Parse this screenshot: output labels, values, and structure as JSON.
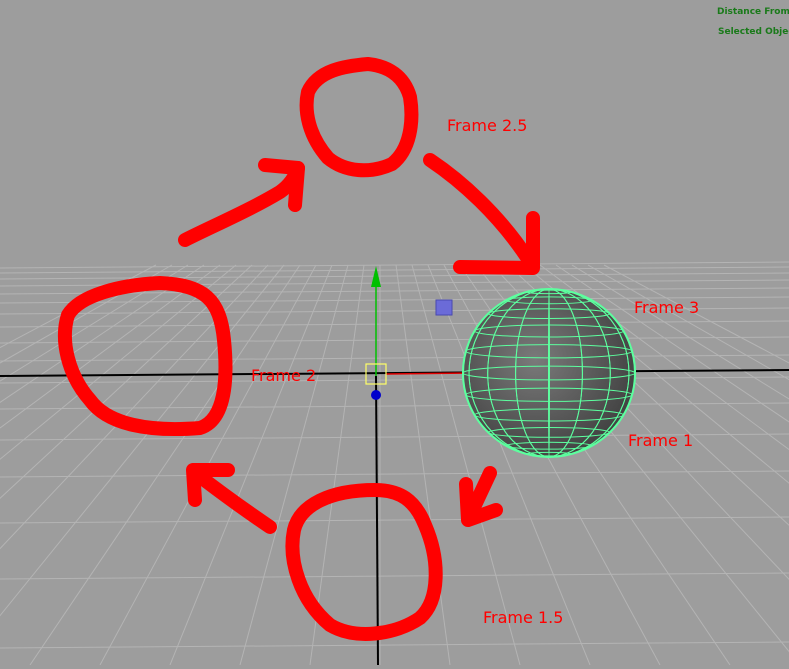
{
  "hud": {
    "distance_label": "Distance From",
    "selected_label": "Selected Objec"
  },
  "annotations": {
    "frame_2_5": "Frame 2.5",
    "frame_3": "Frame 3",
    "frame_2": "Frame 2",
    "frame_1": "Frame 1",
    "frame_1_5": "Frame 1.5"
  },
  "colors": {
    "viewport_bg": "#9d9d9d",
    "grid_line": "#b4b4b4",
    "axis_line": "#000000",
    "annotation_red": "#ff0000",
    "wire_green": "#5dff9f",
    "sphere_gray": "#5a5a5a",
    "hud_green": "#1a7a1a",
    "y_axis_green": "#00c000",
    "manip_yellow": "#ffff66",
    "pivot_blue": "#0000cc"
  }
}
